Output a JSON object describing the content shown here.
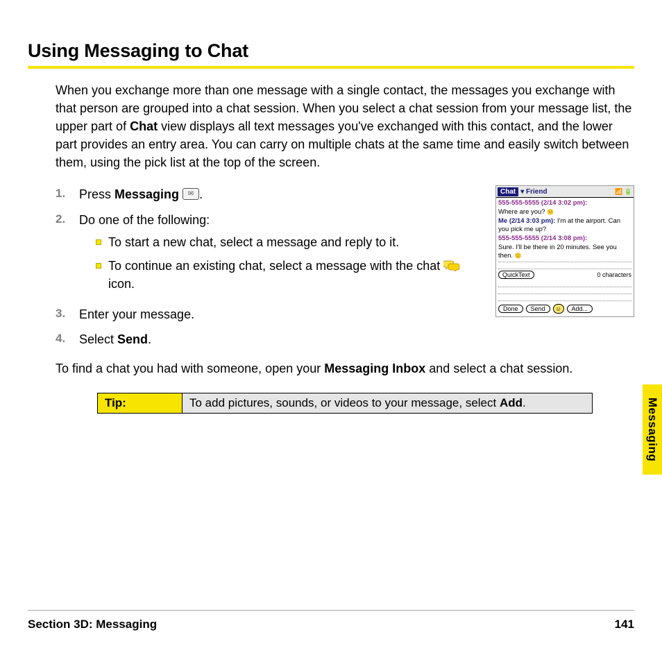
{
  "heading": "Using Messaging to Chat",
  "intro_parts": {
    "p1": "When you exchange more than one message with a single contact, the messages you exchange with that person are grouped into a chat session. When you select a chat session from your message list, the upper part of ",
    "b1": "Chat",
    "p2": " view displays all text messages you've exchanged with this contact, and the lower part provides an entry area. You can carry on multiple chats at the same time and easily switch between them, using the pick list at the top of the screen."
  },
  "steps": {
    "s1a": "Press ",
    "s1b": "Messaging",
    "s1c": ".",
    "s2": "Do one of the following:",
    "s2a": "To start a new chat, select a message and reply to it.",
    "s2b_pre": "To continue an existing chat, select a message with the chat ",
    "s2b_post": " icon.",
    "s3": "Enter your message.",
    "s4a": "Select ",
    "s4b": "Send",
    "s4c": "."
  },
  "after_parts": {
    "p1": "To find a chat you had with someone, open your ",
    "b1": "Messaging Inbox",
    "p2": " and select a chat session."
  },
  "tip": {
    "label": "Tip:",
    "text_pre": "To add pictures, sounds, or videos to your message, select ",
    "text_b": "Add",
    "text_post": "."
  },
  "side_tab": "Messaging",
  "footer": {
    "section": "Section 3D: Messaging",
    "page": "141"
  },
  "palm": {
    "title_chat": "Chat",
    "title_friend": "▾ Friend",
    "m1_hdr": "555-555-5555 (2/14 3:02 pm):",
    "m1_txt": "Where are you? ",
    "m2_hdr": "Me (2/14 3:03 pm):",
    "m2_txt": " I'm at the airport. Can you pick me up?",
    "m3_hdr": "555-555-5555 (2/14 3:08 pm):",
    "m3_txt": "Sure. I'll be there in 20 minutes. See you then. ",
    "quicktext": "QuickText",
    "char_count": "0 characters",
    "btn_done": "Done",
    "btn_send": "Send",
    "btn_add": "Add..."
  }
}
